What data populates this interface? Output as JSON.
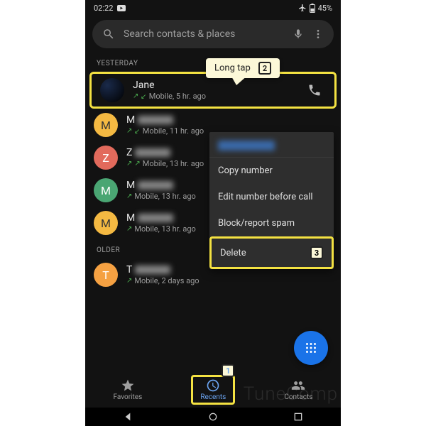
{
  "status": {
    "time": "02:22",
    "battery": "45%"
  },
  "search": {
    "placeholder": "Search contacts & places"
  },
  "sections": {
    "yesterday": "YESTERDAY",
    "older": "OLDER"
  },
  "calls": [
    {
      "name": "Jane",
      "sub": "Mobile, 5 hr. ago"
    },
    {
      "initial": "M",
      "name": "M",
      "sub": "Mobile, 11 hr. ago"
    },
    {
      "initial": "Z",
      "name": "Z",
      "sub": "Mobile, 13 hr. ago"
    },
    {
      "initial": "M",
      "name": "M",
      "sub": "Mobile, 13 hr. ago"
    },
    {
      "initial": "M",
      "name": "M",
      "sub": "Mobile, 13 hr. ago"
    },
    {
      "initial": "T",
      "name": "T",
      "sub": "Mobile, 2 days ago"
    }
  ],
  "menu": {
    "copy": "Copy number",
    "edit": "Edit number before call",
    "block": "Block/report spam",
    "delete": "Delete"
  },
  "nav": {
    "favorites": "Favorites",
    "recents": "Recents",
    "contacts": "Contacts"
  },
  "tooltips": {
    "longtap": "Long tap"
  },
  "badges": {
    "b1": "1",
    "b2": "2",
    "b3": "3"
  },
  "watermark": "TuneComp"
}
